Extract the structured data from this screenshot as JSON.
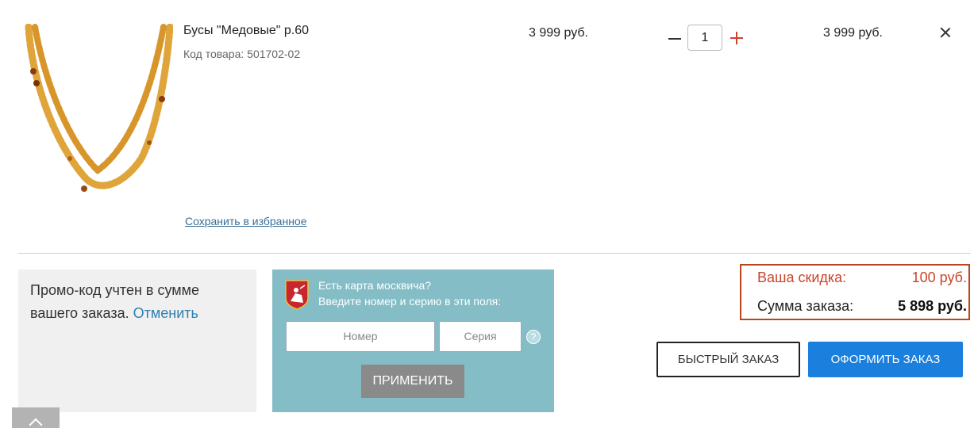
{
  "product": {
    "name": "Бусы \"Медовые\" р.60",
    "code": "Код товара: 501702-02",
    "unit_price": "3 999 руб.",
    "quantity": "1",
    "total_price": "3 999 руб.",
    "save_favorite": "Сохранить в избранное"
  },
  "promo": {
    "text": "Промо-код учтен в сумме вашего заказа.",
    "cancel": "Отменить"
  },
  "moscow_card": {
    "title": "Есть карта москвича?",
    "subtitle": "Введите номер и серию в эти поля:",
    "number_placeholder": "Номер",
    "series_placeholder": "Серия",
    "help": "?",
    "apply": "ПРИМЕНИТЬ"
  },
  "summary": {
    "discount_label": "Ваша скидка:",
    "discount_value": "100 руб.",
    "total_label": "Сумма заказа:",
    "total_value": "5 898 руб."
  },
  "actions": {
    "quick_order": "БЫСТРЫЙ ЗАКАЗ",
    "checkout": "ОФОРМИТЬ ЗАКАЗ"
  },
  "colors": {
    "accent_blue": "#1a7fdd",
    "discount_red": "#c9452b",
    "panel_teal": "#84bdc6"
  }
}
